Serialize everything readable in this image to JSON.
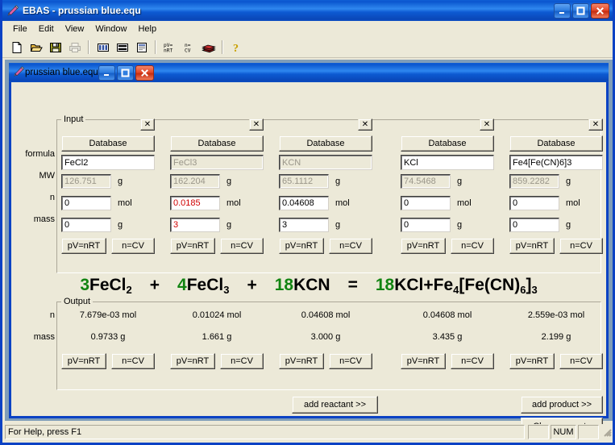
{
  "app": {
    "title": "EBAS - prussian blue.equ",
    "icon": "pencil-icon",
    "menu": [
      "File",
      "Edit",
      "View",
      "Window",
      "Help"
    ],
    "toolbar": [
      {
        "name": "new-icon",
        "tip": "New"
      },
      {
        "name": "open-icon",
        "tip": "Open"
      },
      {
        "name": "save-icon",
        "tip": "Save"
      },
      {
        "name": "print-icon",
        "tip": "Print"
      },
      {
        "name": "columns-view-icon",
        "tip": "Columns"
      },
      {
        "name": "rows-view-icon",
        "tip": "Rows"
      },
      {
        "name": "page-view-icon",
        "tip": "Page"
      },
      {
        "name": "pv-nrt-icon",
        "tip": "pV=nRT"
      },
      {
        "name": "n-cv-icon",
        "tip": "n=CV"
      },
      {
        "name": "book-icon",
        "tip": "Database"
      },
      {
        "name": "help-icon",
        "tip": "Help"
      }
    ],
    "window_buttons": {
      "minimize": "_",
      "maximize": "□",
      "close": "✕"
    }
  },
  "child": {
    "title": "prussian blue.equ",
    "icon": "pencil-icon"
  },
  "input": {
    "legend": "Input",
    "row_labels": [
      "formula",
      "MW",
      "n",
      "mass"
    ],
    "units": {
      "mw": "g",
      "n": "mol",
      "mass": "g"
    },
    "database_label": "Database",
    "close_label": "✕",
    "pv_label": "pV=nRT",
    "ncv_label": "n=CV",
    "columns": [
      {
        "formula": "FeCl2",
        "formula_disabled": false,
        "mw": "126.751",
        "n": "0",
        "n_red": false,
        "mass": "0",
        "mass_red": false
      },
      {
        "formula": "FeCl3",
        "formula_disabled": true,
        "mw": "162.204",
        "n": "0.0185",
        "n_red": true,
        "mass": "3",
        "mass_red": true
      },
      {
        "formula": "KCN",
        "formula_disabled": true,
        "mw": "65.1112",
        "n": "0.04608",
        "n_red": false,
        "mass": "3",
        "mass_red": false
      },
      {
        "formula": "KCl",
        "formula_disabled": false,
        "mw": "74.5468",
        "n": "0",
        "n_red": false,
        "mass": "0",
        "mass_red": false
      },
      {
        "formula": "Fe4[Fe(CN)6]3",
        "formula_disabled": false,
        "mw": "859.2282",
        "n": "0",
        "n_red": false,
        "mass": "0",
        "mass_red": false
      }
    ]
  },
  "equation": {
    "terms": [
      {
        "coefficient": "3",
        "formula": [
          {
            "t": "FeCl"
          },
          {
            "t": "2",
            "sub": true
          }
        ]
      },
      {
        "op": "+"
      },
      {
        "coefficient": "4",
        "formula": [
          {
            "t": "FeCl"
          },
          {
            "t": "3",
            "sub": true
          }
        ]
      },
      {
        "op": "+"
      },
      {
        "coefficient": "18",
        "formula": [
          {
            "t": "KCN"
          }
        ]
      },
      {
        "op": "="
      },
      {
        "coefficient": "18",
        "formula": [
          {
            "t": "KCl"
          }
        ]
      },
      {
        "op": "+",
        "tight": true
      },
      {
        "coefficient": "",
        "formula": [
          {
            "t": "Fe"
          },
          {
            "t": "4",
            "sub": true
          },
          {
            "t": "[Fe(CN)"
          },
          {
            "t": "6",
            "sub": true
          },
          {
            "t": "]"
          },
          {
            "t": "3",
            "sub": true
          }
        ]
      }
    ],
    "coefficient_color": "#128412",
    "text_color": "#000000"
  },
  "output": {
    "legend": "Output",
    "row_labels": [
      "n",
      "mass"
    ],
    "pv_label": "pV=nRT",
    "ncv_label": "n=CV",
    "columns": [
      {
        "n": "7.679e-03 mol",
        "mass": "0.9733 g"
      },
      {
        "n": "0.01024 mol",
        "mass": "1.661 g"
      },
      {
        "n": "0.04608 mol",
        "mass": "3.000 g"
      },
      {
        "n": "0.04608 mol",
        "mass": "3.435 g"
      },
      {
        "n": "2.559e-03 mol",
        "mass": "2.199 g"
      }
    ]
  },
  "actions": {
    "add_reactant": "add reactant >>",
    "add_product": "add product >>",
    "clear_amounts": "Clear amounts"
  },
  "statusbar": {
    "message": "For Help, press F1",
    "indicator_blank1": "",
    "indicator_num": "NUM",
    "indicator_blank2": ""
  }
}
